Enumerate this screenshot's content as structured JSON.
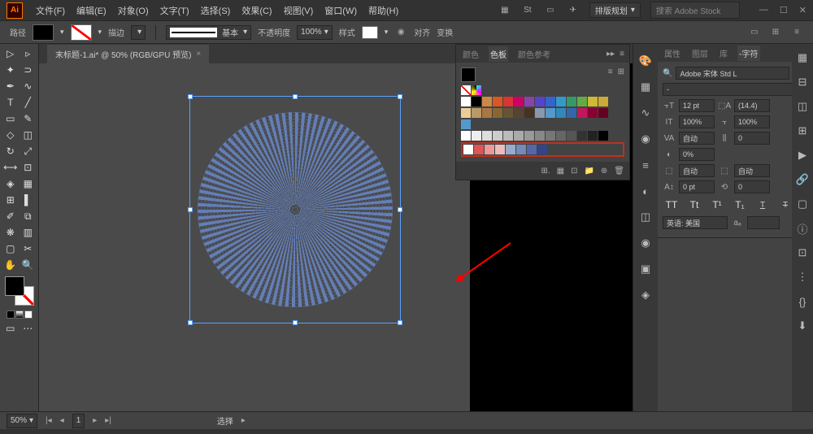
{
  "app": {
    "logo": "Ai"
  },
  "menu": [
    "文件(F)",
    "编辑(E)",
    "对象(O)",
    "文字(T)",
    "选择(S)",
    "效果(C)",
    "视图(V)",
    "窗口(W)",
    "帮助(H)"
  ],
  "title": {
    "layout_dropdown": "排版规划",
    "search_placeholder": "搜索 Adobe Stock"
  },
  "options": {
    "path": "路径",
    "stroke": "描边",
    "stroke_width": "",
    "style_label": "基本",
    "opacity_label": "不透明度",
    "opacity": "100%",
    "style2": "样式",
    "align": "对齐",
    "transform": "变换"
  },
  "tab": {
    "title": "末标题-1.ai* @ 50% (RGB/GPU 预览)"
  },
  "colorpanel": {
    "tabs": [
      "颜色",
      "色板",
      "颜色参考"
    ],
    "row1": [
      "#ffffff",
      "#000000",
      "#cc8844",
      "#dd5522",
      "#dd3333",
      "#cc0066",
      "#8844aa",
      "#5544cc",
      "#3366cc",
      "#3399cc",
      "#339966",
      "#66aa44",
      "#ccbb33",
      "#ccaa33"
    ],
    "row2": [
      "#eecc99",
      "#bb9966",
      "#aa7744",
      "#886633",
      "#665533",
      "#554433",
      "#443322",
      "#8899aa",
      "#5599cc",
      "#3388bb",
      "#3366aa",
      "#c2185b",
      "#880033",
      "#660022"
    ],
    "row3": [
      "#ffffff",
      "#eeeeee",
      "#dddddd",
      "#cccccc",
      "#bbbbbb",
      "#aaaaaa",
      "#999999",
      "#888888",
      "#777777",
      "#666666",
      "#555555",
      "#333333",
      "#222222",
      "#000000"
    ],
    "highlight": [
      "#ffffff",
      "#dd5555",
      "#ee9999",
      "#eebbbb",
      "#99aacc",
      "#7788bb",
      "#5566aa",
      "#334488"
    ]
  },
  "char": {
    "tabs": [
      "属性",
      "图层",
      "库",
      "字符"
    ],
    "font": "Adobe 宋体 Std L",
    "style": "-",
    "size": "12 pt",
    "leading": "(14.4)",
    "kerning": "0",
    "tracking": "100%",
    "vscale": "自动",
    "baseline": "0",
    "opacity_val": "0%",
    "auto1": "自动",
    "auto2": "自动",
    "pt0": "0 pt",
    "lang": "英语: 美国"
  },
  "status": {
    "zoom": "50%",
    "page": "1",
    "tool": "选择"
  }
}
